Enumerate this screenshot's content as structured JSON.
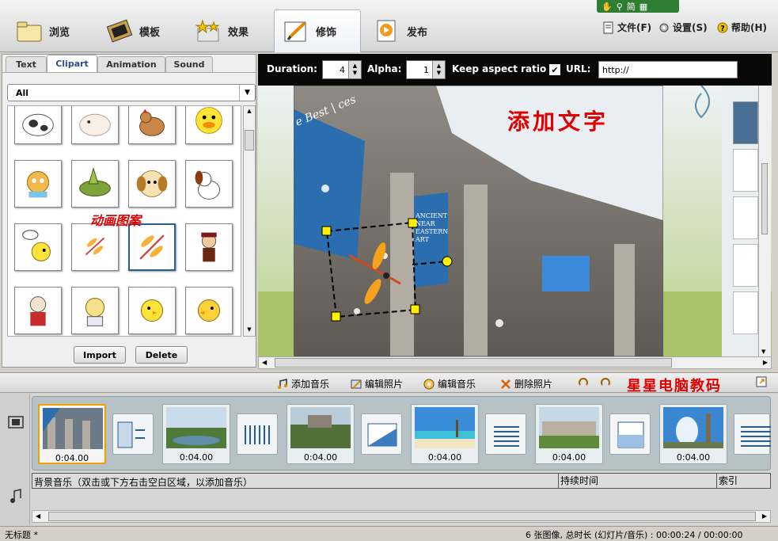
{
  "tabs": [
    {
      "label": "浏览",
      "icon": "folder-icon"
    },
    {
      "label": "模板",
      "icon": "film-icon"
    },
    {
      "label": "效果",
      "icon": "stars-icon"
    },
    {
      "label": "修饰",
      "icon": "pencil-icon",
      "active": true
    },
    {
      "label": "发布",
      "icon": "publish-icon"
    }
  ],
  "lang_bar": {
    "label": "简",
    "icons": [
      "hand-icon",
      "search-icon",
      "keyboard-icon"
    ]
  },
  "menu": [
    {
      "label": "文件(F)",
      "icon": "file-icon"
    },
    {
      "label": "设置(S)",
      "icon": "settings-icon"
    },
    {
      "label": "帮助(H)",
      "icon": "help-icon"
    }
  ],
  "panel": {
    "tabs": [
      "Text",
      "Clipart",
      "Animation",
      "Sound"
    ],
    "active_tab": "Clipart",
    "category": "All",
    "annotation": "动画图案",
    "import_label": "Import",
    "delete_label": "Delete"
  },
  "editor": {
    "duration_label": "Duration:",
    "duration_value": "4",
    "alpha_label": "Alpha:",
    "alpha_value": "1",
    "aspect_label": "Keep aspect ratio",
    "aspect_checked": true,
    "url_label": "URL:",
    "url_value": "http://"
  },
  "canvas": {
    "overlay_text": "添加文字",
    "banner_left": "e Best | ces",
    "banner_right": "ANCIENT NEAR EASTERN ART"
  },
  "toolbar": {
    "add_music": "添加音乐",
    "edit_photo": "编辑照片",
    "edit_music": "编辑音乐",
    "delete_photo": "删除照片",
    "brand": "星星电脑教码"
  },
  "slides": [
    {
      "duration": "0:04.00",
      "scene": "museum",
      "selected": true
    },
    {
      "duration": "0:04.00",
      "scene": "lake"
    },
    {
      "duration": "0:04.00",
      "scene": "castle"
    },
    {
      "duration": "0:04.00",
      "scene": "beach"
    },
    {
      "duration": "0:04.00",
      "scene": "palace"
    },
    {
      "duration": "0:04.00",
      "scene": "fountain"
    }
  ],
  "music": {
    "hint": "背景音乐（双击或下方右击空白区域，以添加音乐）",
    "duration_header": "持续时间",
    "index_header": "索引"
  },
  "status": {
    "title": "无标题 *",
    "summary": "6 张图像, 总时长 (幻灯片/音乐) : 00:00:24 / 00:00:00"
  },
  "colors": {
    "accent": "#2a5d8f",
    "brand": "#e00000",
    "status_green": "#2e7d32",
    "toolbar": "#080808"
  }
}
